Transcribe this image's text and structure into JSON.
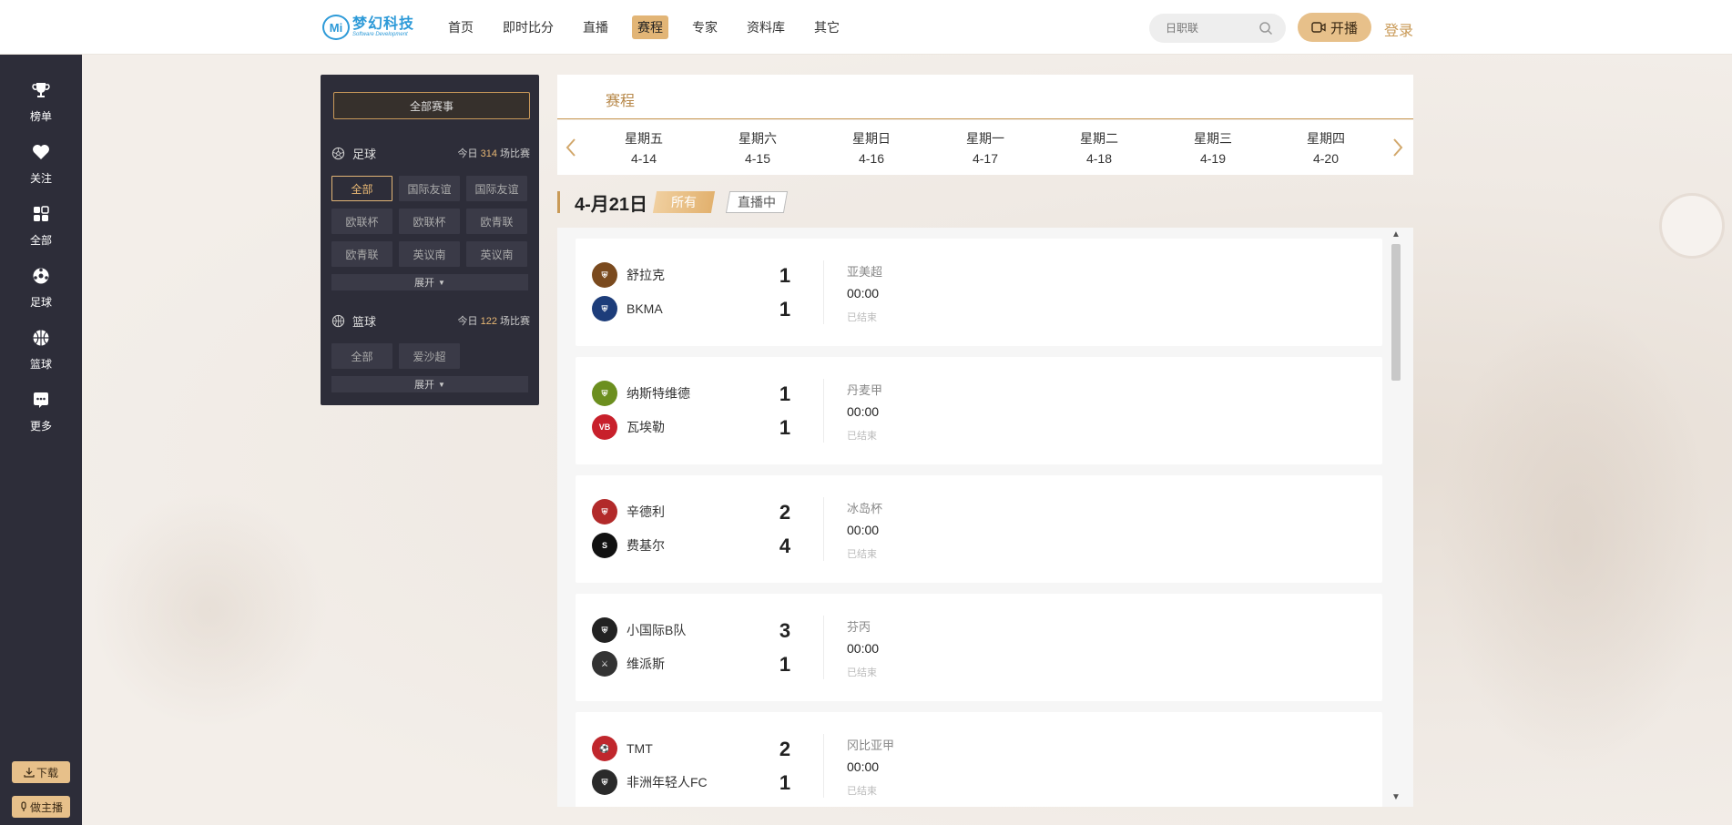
{
  "header": {
    "logo_cn": "梦幻科技",
    "logo_en": "Software Development",
    "logo_badge": "Mi",
    "nav": [
      "首页",
      "即时比分",
      "直播",
      "赛程",
      "专家",
      "资料库",
      "其它"
    ],
    "active_nav": "赛程",
    "search_placeholder": "日职联",
    "live_label": "开播",
    "login_label": "登录"
  },
  "sidebar": {
    "items": [
      {
        "label": "榜单",
        "icon": "trophy-icon"
      },
      {
        "label": "关注",
        "icon": "heart-icon"
      },
      {
        "label": "全部",
        "icon": "grid-icon"
      },
      {
        "label": "足球",
        "icon": "football-icon"
      },
      {
        "label": "篮球",
        "icon": "basketball-icon"
      },
      {
        "label": "更多",
        "icon": "more-icon"
      }
    ],
    "download_label": "下载",
    "host_label": "做主播"
  },
  "filter": {
    "all_events_label": "全部赛事",
    "football": {
      "name": "足球",
      "today_prefix": "今日",
      "today_count": "314",
      "today_suffix": "场比赛",
      "chips": [
        "全部",
        "国际友谊",
        "国际友谊",
        "欧联杯",
        "欧联杯",
        "欧青联",
        "欧青联",
        "英议南",
        "英议南"
      ],
      "expand_label": "展开"
    },
    "basketball": {
      "name": "篮球",
      "today_prefix": "今日",
      "today_count": "122",
      "today_suffix": "场比赛",
      "chips": [
        "全部",
        "爱沙超"
      ],
      "expand_label": "展开"
    }
  },
  "schedule": {
    "title": "赛程",
    "days": [
      {
        "weekday": "星期五",
        "date": "4-14"
      },
      {
        "weekday": "星期六",
        "date": "4-15"
      },
      {
        "weekday": "星期日",
        "date": "4-16"
      },
      {
        "weekday": "星期一",
        "date": "4-17"
      },
      {
        "weekday": "星期二",
        "date": "4-18"
      },
      {
        "weekday": "星期三",
        "date": "4-19"
      },
      {
        "weekday": "星期四",
        "date": "4-20"
      }
    ],
    "current_date": "4-月21日",
    "tag_all": "所有",
    "tag_live": "直播中",
    "matches": [
      {
        "home": "舒拉克",
        "away": "BKMA",
        "home_score": "1",
        "away_score": "1",
        "league": "亚美超",
        "time": "00:00",
        "status": "已结束",
        "home_color": "#7a4a1e",
        "away_color": "#1d3d7a"
      },
      {
        "home": "纳斯特维德",
        "away": "瓦埃勒",
        "home_score": "1",
        "away_score": "1",
        "league": "丹麦甲",
        "time": "00:00",
        "status": "已结束",
        "home_color": "#6c8f1f",
        "away_color": "#c8202b"
      },
      {
        "home": "辛德利",
        "away": "费基尔",
        "home_score": "2",
        "away_score": "4",
        "league": "冰岛杯",
        "time": "00:00",
        "status": "已结束",
        "home_color": "#b22a2a",
        "away_color": "#111111"
      },
      {
        "home": "小国际B队",
        "away": "维派斯",
        "home_score": "3",
        "away_score": "1",
        "league": "芬丙",
        "time": "00:00",
        "status": "已结束",
        "home_color": "#222222",
        "away_color": "#333333"
      },
      {
        "home": "TMT",
        "away": "非洲年轻人FC",
        "home_score": "2",
        "away_score": "1",
        "league": "冈比亚甲",
        "time": "00:00",
        "status": "已结束",
        "home_color": "#c0272d",
        "away_color": "#2a2a2a"
      }
    ]
  }
}
